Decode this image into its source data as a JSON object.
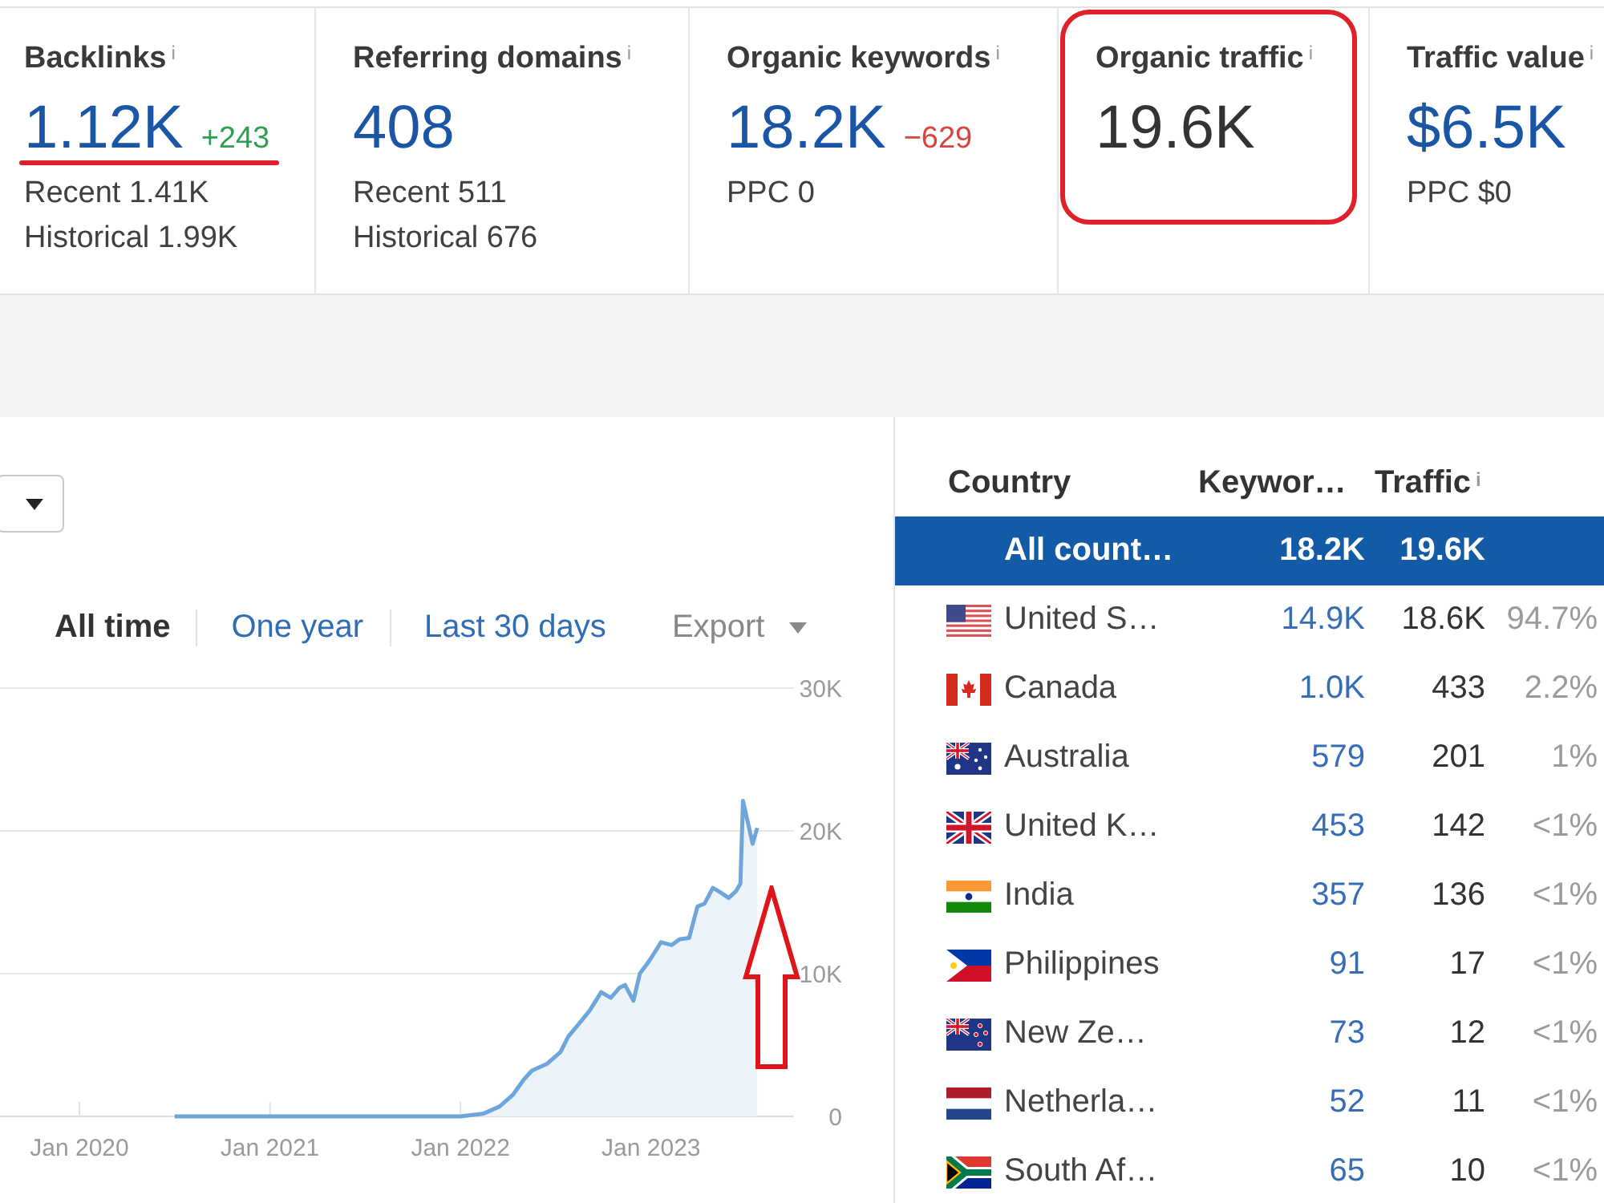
{
  "metrics": [
    {
      "label": "Backlinks",
      "info": "i",
      "value": "1.12K",
      "linked": true,
      "delta": "+243",
      "delta_rising": true,
      "underlined": true,
      "details": [
        "Recent 1.41K",
        "Historical 1.99K"
      ]
    },
    {
      "label": "Referring domains",
      "info": "i",
      "value": "408",
      "linked": true,
      "details": [
        "Recent 511",
        "Historical 676"
      ]
    },
    {
      "label": "Organic keywords",
      "info": "i",
      "value": "18.2K",
      "linked": true,
      "delta": "−629",
      "delta_rising": false,
      "details": [
        "PPC 0"
      ]
    },
    {
      "label": "Organic traffic",
      "info": "i",
      "value": "19.6K",
      "linked": false,
      "circled": true
    },
    {
      "label": "Traffic value",
      "info": "i",
      "value": "$6.5K",
      "linked": true,
      "details": [
        "PPC $0"
      ]
    }
  ],
  "chart_panel": {
    "period_tabs": [
      {
        "label": "All time",
        "selected": true
      },
      {
        "label": "One year",
        "selected": false
      },
      {
        "label": "Last 30 days",
        "selected": false
      }
    ],
    "export": "Export",
    "arrow_annotation": true,
    "chart_data": {
      "type": "area",
      "x": [
        "2020-07",
        "2021-01",
        "2021-07",
        "2022-01",
        "2022-02-15",
        "2022-03-15",
        "2022-04-10",
        "2022-05-01",
        "2022-05-16",
        "2022-06-15",
        "2022-07-10",
        "2022-07-25",
        "2022-08-15",
        "2022-09-05",
        "2022-09-27",
        "2022-10-15",
        "2022-11-01",
        "2022-11-12",
        "2022-11-28",
        "2022-12-10",
        "2022-12-28",
        "2023-01-20",
        "2023-02-10",
        "2023-02-25",
        "2023-03-13",
        "2023-03-29",
        "2023-04-12",
        "2023-04-28",
        "2023-05-12",
        "2023-05-28",
        "2023-06-12",
        "2023-06-20",
        "2023-06-25",
        "2023-07-05",
        "2023-07-13",
        "2023-07-22"
      ],
      "values": [
        0,
        0,
        0,
        0,
        200,
        700,
        1500,
        2600,
        3200,
        3700,
        4500,
        5600,
        6500,
        7400,
        8700,
        8300,
        9000,
        9200,
        8100,
        10000,
        10900,
        12200,
        12000,
        12400,
        12500,
        14700,
        14900,
        16000,
        15700,
        15300,
        15800,
        16300,
        22100,
        20400,
        19100,
        20200
      ],
      "xlim": [
        "2019-08",
        "2023-10"
      ],
      "ylim": [
        0,
        30000
      ],
      "xticks": [
        {
          "value": "2020-01",
          "label": "Jan 2020"
        },
        {
          "value": "2021-01",
          "label": "Jan 2021"
        },
        {
          "value": "2022-01",
          "label": "Jan 2022"
        },
        {
          "value": "2023-01",
          "label": "Jan 2023"
        }
      ],
      "yticks": [
        {
          "value": 0,
          "label": "0"
        },
        {
          "value": 10000,
          "label": "10K"
        },
        {
          "value": 20000,
          "label": "20K"
        },
        {
          "value": 30000,
          "label": "30K"
        }
      ]
    }
  },
  "countries": {
    "columns": [
      {
        "label": "Country"
      },
      {
        "label": "Keywor…"
      },
      {
        "label": "Traffic",
        "info": "i"
      }
    ],
    "rows": [
      {
        "kind": "total",
        "name": "All count…",
        "keywords": "18.2K",
        "traffic": "19.6K",
        "selected": true
      },
      {
        "kind": "us",
        "name": "United S…",
        "keywords": "14.9K",
        "traffic": "18.6K",
        "share": "94.7%",
        "selected": false
      },
      {
        "kind": "ca",
        "name": "Canada",
        "keywords": "1.0K",
        "traffic": "433",
        "share": "2.2%",
        "selected": false
      },
      {
        "kind": "au",
        "name": "Australia",
        "keywords": "579",
        "traffic": "201",
        "share": "1%",
        "selected": false
      },
      {
        "kind": "gb",
        "name": "United K…",
        "keywords": "453",
        "traffic": "142",
        "share": "<1%",
        "selected": false
      },
      {
        "kind": "in",
        "name": "India",
        "keywords": "357",
        "traffic": "136",
        "share": "<1%",
        "selected": false
      },
      {
        "kind": "ph",
        "name": "Philippines",
        "keywords": "91",
        "traffic": "17",
        "share": "<1%",
        "selected": false
      },
      {
        "kind": "nz",
        "name": "New Ze…",
        "keywords": "73",
        "traffic": "12",
        "share": "<1%",
        "selected": false
      },
      {
        "kind": "nl",
        "name": "Netherla…",
        "keywords": "52",
        "traffic": "11",
        "share": "<1%",
        "selected": false
      },
      {
        "kind": "za",
        "name": "South Af…",
        "keywords": "65",
        "traffic": "10",
        "share": "<1%",
        "selected": false
      }
    ]
  }
}
